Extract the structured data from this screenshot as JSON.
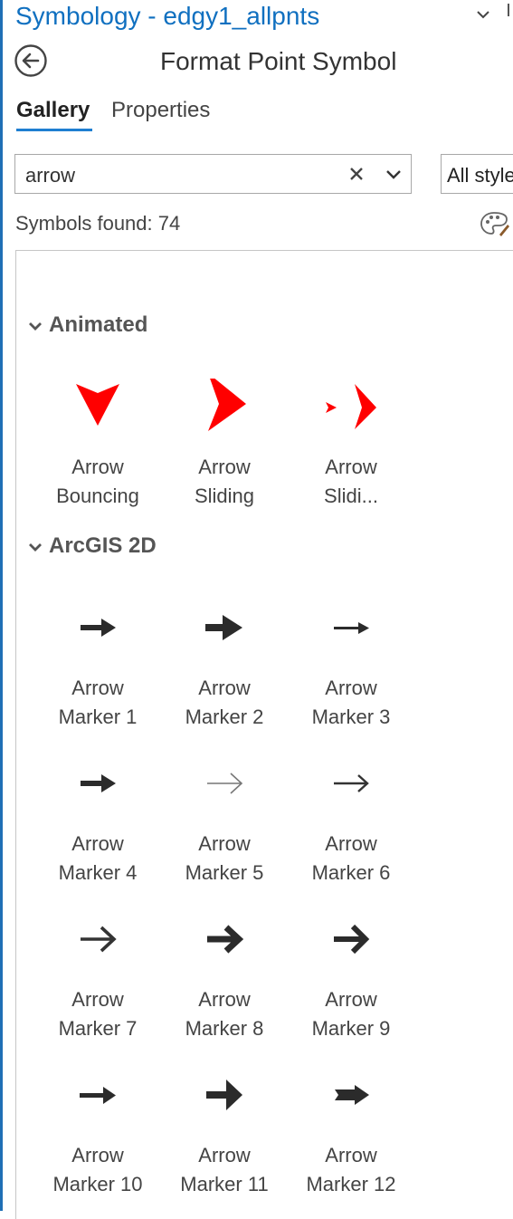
{
  "pane": {
    "title": "Symbology - edgy1_allpnts"
  },
  "header": {
    "title": "Format Point Symbol",
    "back_icon": "back-arrow-circle-icon"
  },
  "tabs": [
    {
      "label": "Gallery",
      "selected": true
    },
    {
      "label": "Properties",
      "selected": false
    }
  ],
  "search": {
    "value": "arrow",
    "clear_icon": "close-icon",
    "dropdown_icon": "chevron-down-icon"
  },
  "style_filter": {
    "value": "All styles"
  },
  "results": {
    "found_text": "Symbols found: 74",
    "palette_icon": "palette-icon"
  },
  "colors": {
    "accent": "#1f7fd1",
    "title": "#1070c0",
    "arrow_red": "#ff0000",
    "arrow_dark": "#2b2b2b"
  },
  "groups": [
    {
      "name": "Animated",
      "symbols": [
        {
          "line1": "Arrow",
          "line2": "Bouncing",
          "icon": "arrow-bouncing-icon"
        },
        {
          "line1": "Arrow",
          "line2": "Sliding",
          "icon": "arrow-sliding-icon"
        },
        {
          "line1": "Arrow",
          "line2": "Slidi...",
          "icon": "arrow-sliding-2-icon"
        }
      ]
    },
    {
      "name": "ArcGIS 2D",
      "symbols": [
        {
          "line1": "Arrow",
          "line2": "Marker 1",
          "icon": "arrow-marker-1-icon"
        },
        {
          "line1": "Arrow",
          "line2": "Marker 2",
          "icon": "arrow-marker-2-icon"
        },
        {
          "line1": "Arrow",
          "line2": "Marker 3",
          "icon": "arrow-marker-3-icon"
        },
        {
          "line1": "Arrow",
          "line2": "Marker 4",
          "icon": "arrow-marker-4-icon"
        },
        {
          "line1": "Arrow",
          "line2": "Marker 5",
          "icon": "arrow-marker-5-icon"
        },
        {
          "line1": "Arrow",
          "line2": "Marker 6",
          "icon": "arrow-marker-6-icon"
        },
        {
          "line1": "Arrow",
          "line2": "Marker 7",
          "icon": "arrow-marker-7-icon"
        },
        {
          "line1": "Arrow",
          "line2": "Marker 8",
          "icon": "arrow-marker-8-icon"
        },
        {
          "line1": "Arrow",
          "line2": "Marker 9",
          "icon": "arrow-marker-9-icon"
        },
        {
          "line1": "Arrow",
          "line2": "Marker 10",
          "icon": "arrow-marker-10-icon"
        },
        {
          "line1": "Arrow",
          "line2": "Marker 11",
          "icon": "arrow-marker-11-icon"
        },
        {
          "line1": "Arrow",
          "line2": "Marker 12",
          "icon": "arrow-marker-12-icon"
        }
      ]
    }
  ]
}
